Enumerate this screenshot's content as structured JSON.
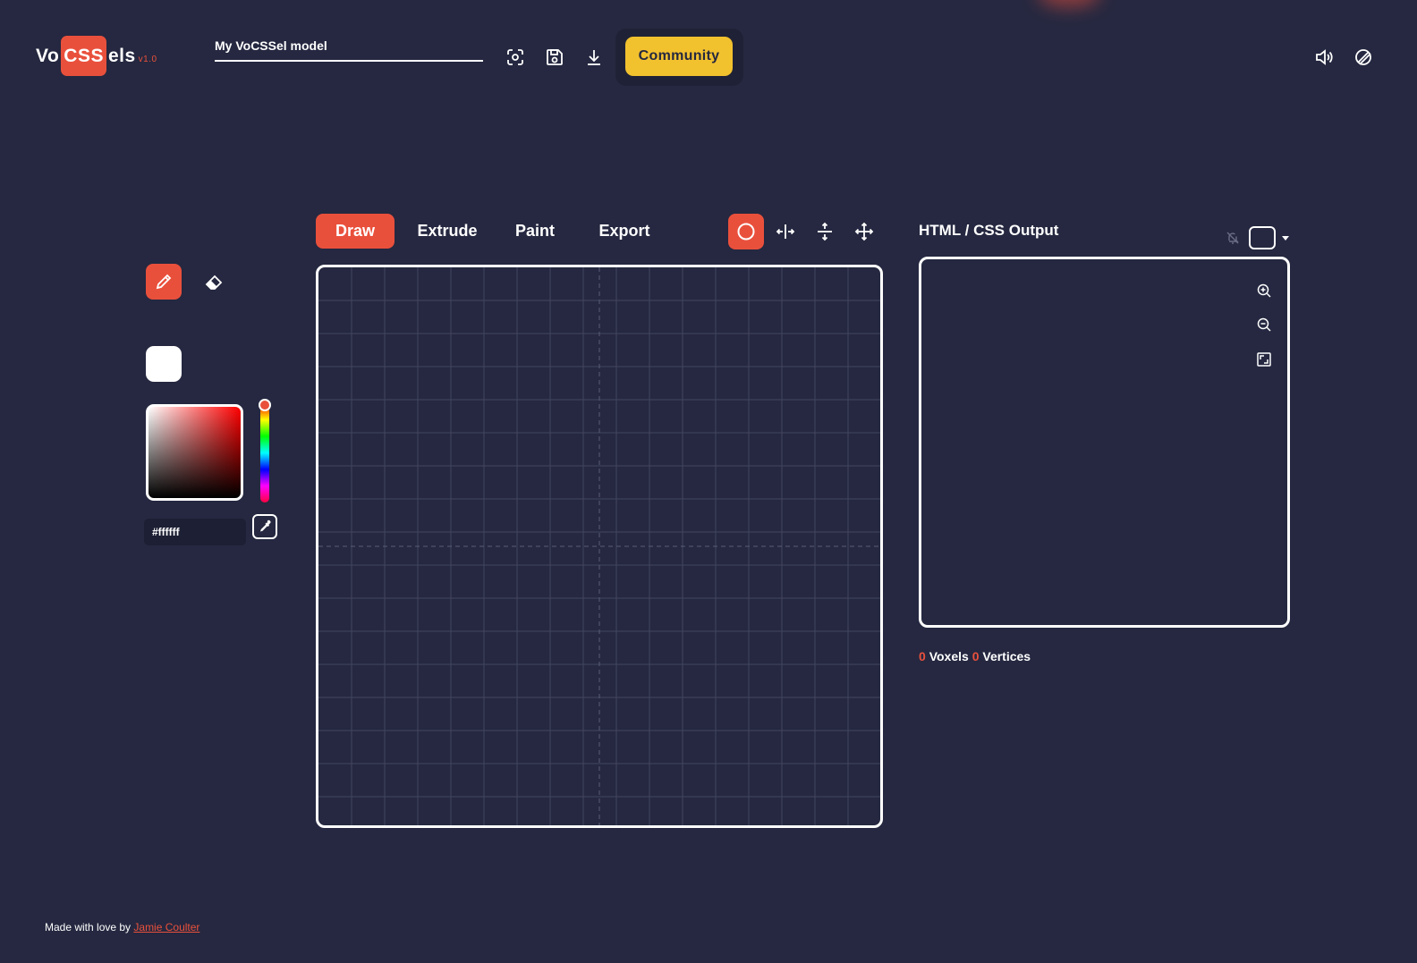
{
  "logo": {
    "part1": "Vo",
    "part2": "CSS",
    "part3": "els",
    "version": "v1.0"
  },
  "header": {
    "model_name": "My VoCSSel model",
    "community_label": "Community",
    "icons": [
      "camera-rotate-icon",
      "save-icon",
      "download-icon",
      "volume-icon",
      "theme-icon"
    ]
  },
  "tabs": [
    "Draw",
    "Extrude",
    "Paint",
    "Export"
  ],
  "active_tab": "Draw",
  "tools": [
    "circle-icon",
    "mirror-horizontal-icon",
    "mirror-vertical-icon",
    "move-icon"
  ],
  "left_panel": {
    "tools": [
      "pencil-icon",
      "eraser-icon"
    ],
    "selected_color": "#ffffff",
    "hex_value": "#ffffff"
  },
  "output": {
    "title": "HTML / CSS Output",
    "zoom_icons": [
      "zoom-in-icon",
      "zoom-out-icon",
      "fit-icon"
    ]
  },
  "stats": {
    "voxels_count": "0",
    "voxels_label": "Voxels",
    "vertices_count": "0",
    "vertices_label": "Vertices"
  },
  "footer": {
    "prefix": "Made with love by",
    "author": "Jamie Coulter"
  },
  "colors": {
    "background": "#252840",
    "accent": "#e9503c",
    "community": "#f2c12e"
  }
}
